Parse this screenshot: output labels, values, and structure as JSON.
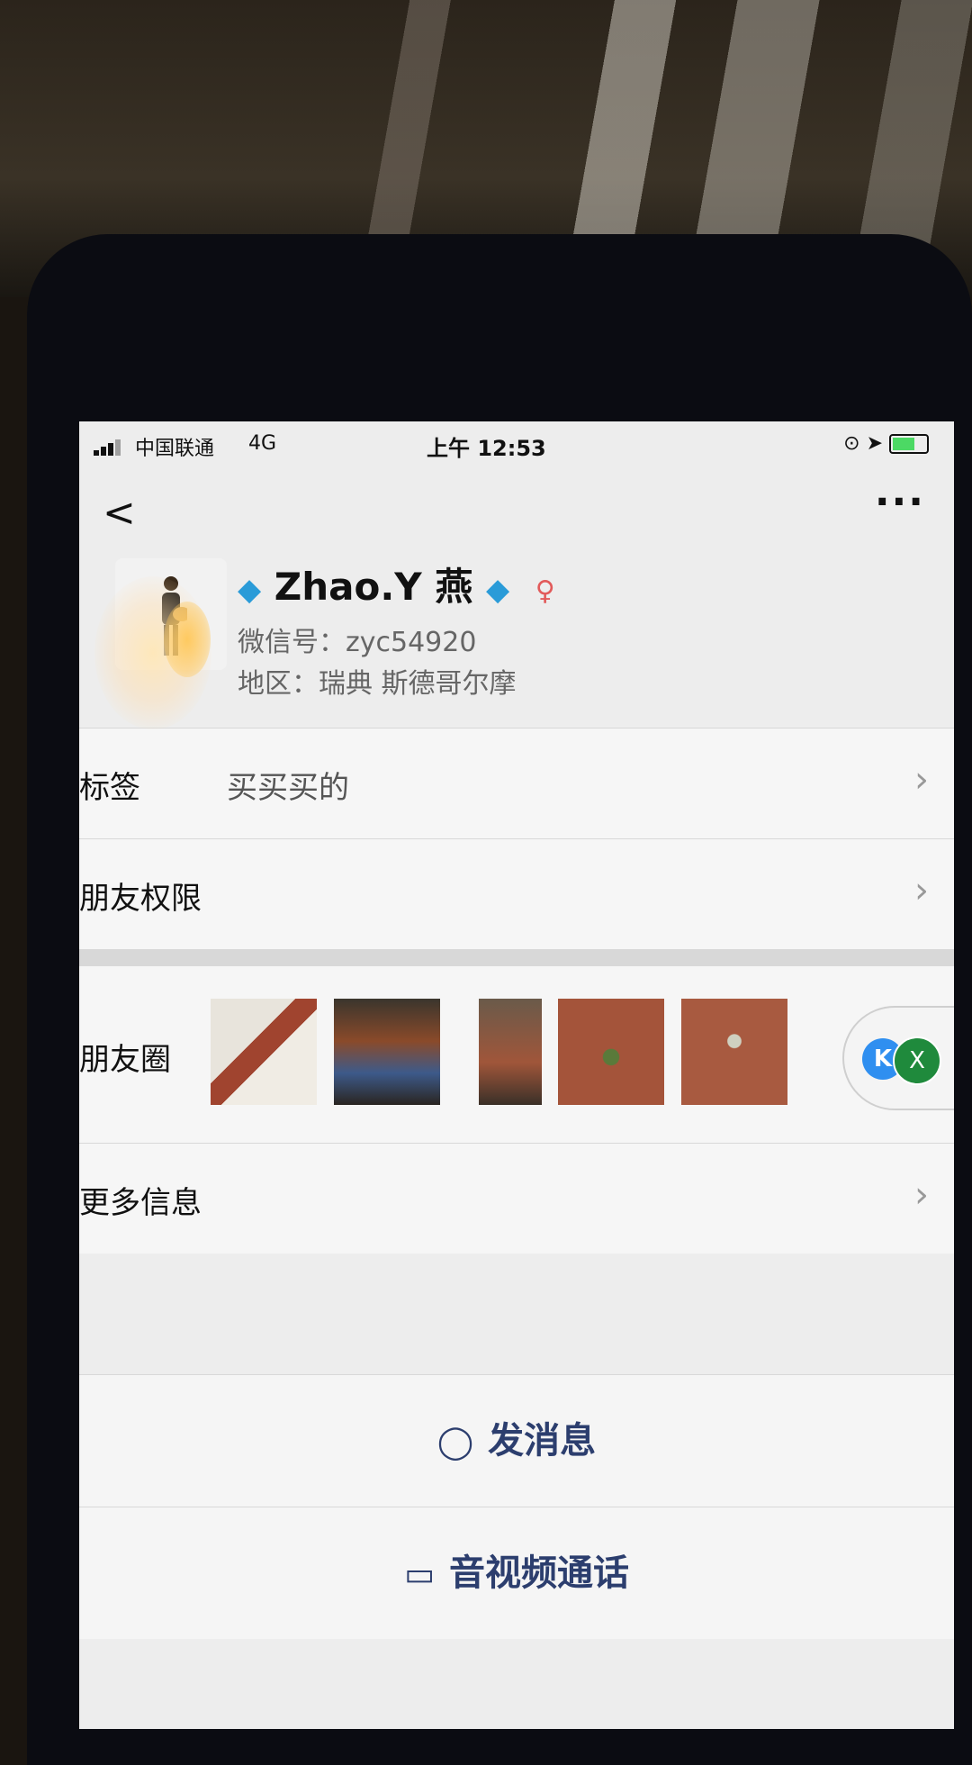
{
  "status_bar": {
    "carrier": "中国联通",
    "network": "4G",
    "time": "上午 12:53"
  },
  "nav": {
    "back_icon": "chevron-left-icon",
    "more_icon": "more-dots-icon"
  },
  "profile": {
    "name": "Zhao.Y 燕",
    "decoration_icon": "diamond-icon",
    "gender_icon": "female-icon",
    "wechat_id": "微信号：zyc54920",
    "region": "地区：瑞典 斯德哥尔摩"
  },
  "cells": {
    "tags_label": "标签",
    "tags_value": "买买买的",
    "friend_permission_label": "朋友权限",
    "moments_label": "朋友圈",
    "more_info_label": "更多信息"
  },
  "floating": {
    "icon1": "K",
    "icon2": "X"
  },
  "actions": {
    "send_message": "发消息",
    "av_call": "音视频通话"
  }
}
